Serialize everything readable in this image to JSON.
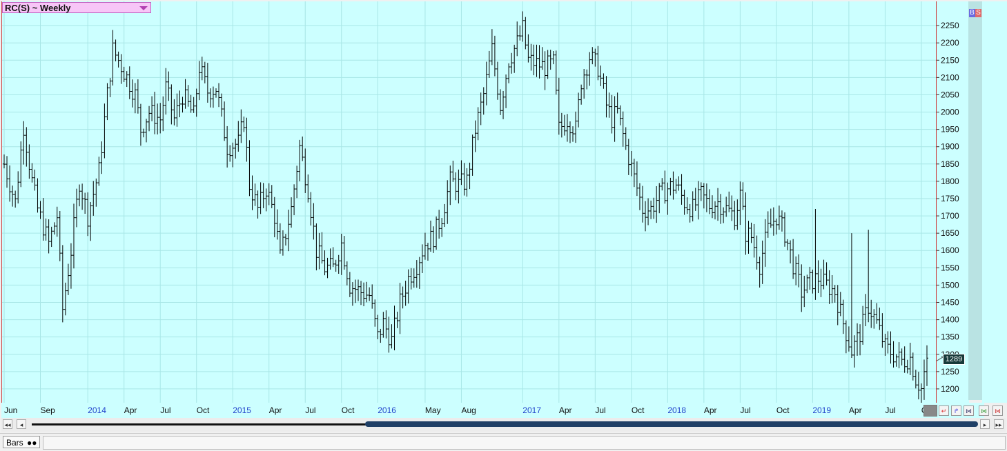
{
  "symbol_title": "RC(S) ~ Weekly",
  "bs_labels": {
    "b": "B",
    "s": "S"
  },
  "last_price": "1289",
  "status_tab": "Bars",
  "colors": {
    "background": "#ccffff",
    "bars": "#000000",
    "grid": "#a8e6e6"
  },
  "chart_data": {
    "type": "ohlc",
    "frequency": "weekly",
    "title": "RC(S) ~ Weekly",
    "ylim": [
      1160,
      2320
    ],
    "y_ticks": [
      1200,
      1250,
      1300,
      1350,
      1400,
      1450,
      1500,
      1550,
      1600,
      1650,
      1700,
      1750,
      1800,
      1850,
      1900,
      1950,
      2000,
      2050,
      2100,
      2150,
      2200,
      2250
    ],
    "x_ticks": [
      {
        "label": "Jun",
        "year": false,
        "pos": 0
      },
      {
        "label": "Sep",
        "year": false,
        "pos": 13
      },
      {
        "label": "2014",
        "year": true,
        "pos": 30
      },
      {
        "label": "Apr",
        "year": false,
        "pos": 43
      },
      {
        "label": "Jul",
        "year": false,
        "pos": 56
      },
      {
        "label": "Oct",
        "year": false,
        "pos": 69
      },
      {
        "label": "2015",
        "year": true,
        "pos": 82
      },
      {
        "label": "Apr",
        "year": false,
        "pos": 95
      },
      {
        "label": "Jul",
        "year": false,
        "pos": 108
      },
      {
        "label": "Oct",
        "year": false,
        "pos": 121
      },
      {
        "label": "2016",
        "year": true,
        "pos": 134
      },
      {
        "label": "May",
        "year": false,
        "pos": 151
      },
      {
        "label": "Aug",
        "year": false,
        "pos": 164
      },
      {
        "label": "2017",
        "year": true,
        "pos": 186
      },
      {
        "label": "Apr",
        "year": false,
        "pos": 199
      },
      {
        "label": "Jul",
        "year": false,
        "pos": 212
      },
      {
        "label": "Oct",
        "year": false,
        "pos": 225
      },
      {
        "label": "2018",
        "year": true,
        "pos": 238
      },
      {
        "label": "Apr",
        "year": false,
        "pos": 251
      },
      {
        "label": "Jul",
        "year": false,
        "pos": 264
      },
      {
        "label": "Oct",
        "year": false,
        "pos": 277
      },
      {
        "label": "2019",
        "year": true,
        "pos": 290
      },
      {
        "label": "Apr",
        "year": false,
        "pos": 303
      },
      {
        "label": "Jul",
        "year": false,
        "pos": 316
      },
      {
        "label": "Oct",
        "year": false,
        "pos": 329
      }
    ],
    "price_anchors": [
      [
        0,
        1850
      ],
      [
        4,
        1740
      ],
      [
        7,
        1960
      ],
      [
        10,
        1800
      ],
      [
        12,
        1720
      ],
      [
        16,
        1620
      ],
      [
        19,
        1700
      ],
      [
        21,
        1430
      ],
      [
        24,
        1600
      ],
      [
        27,
        1800
      ],
      [
        30,
        1700
      ],
      [
        34,
        1830
      ],
      [
        37,
        2050
      ],
      [
        39,
        2180
      ],
      [
        41,
        2150
      ],
      [
        44,
        2100
      ],
      [
        47,
        2050
      ],
      [
        49,
        1950
      ],
      [
        52,
        2000
      ],
      [
        56,
        1980
      ],
      [
        58,
        2070
      ],
      [
        61,
        1980
      ],
      [
        64,
        2050
      ],
      [
        68,
        1990
      ],
      [
        70,
        2130
      ],
      [
        73,
        2060
      ],
      [
        76,
        2070
      ],
      [
        80,
        1900
      ],
      [
        84,
        1910
      ],
      [
        86,
        1980
      ],
      [
        88,
        1790
      ],
      [
        91,
        1720
      ],
      [
        94,
        1780
      ],
      [
        97,
        1700
      ],
      [
        99,
        1580
      ],
      [
        103,
        1720
      ],
      [
        106,
        1900
      ],
      [
        109,
        1780
      ],
      [
        112,
        1600
      ],
      [
        115,
        1550
      ],
      [
        118,
        1550
      ],
      [
        121,
        1620
      ],
      [
        124,
        1500
      ],
      [
        128,
        1480
      ],
      [
        131,
        1470
      ],
      [
        134,
        1350
      ],
      [
        136,
        1390
      ],
      [
        139,
        1340
      ],
      [
        142,
        1450
      ],
      [
        145,
        1520
      ],
      [
        148,
        1560
      ],
      [
        151,
        1620
      ],
      [
        154,
        1640
      ],
      [
        157,
        1700
      ],
      [
        160,
        1800
      ],
      [
        163,
        1790
      ],
      [
        166,
        1800
      ],
      [
        169,
        1950
      ],
      [
        172,
        2050
      ],
      [
        175,
        2180
      ],
      [
        178,
        2020
      ],
      [
        181,
        2150
      ],
      [
        184,
        2200
      ],
      [
        186,
        2240
      ],
      [
        188,
        2150
      ],
      [
        191,
        2140
      ],
      [
        194,
        2130
      ],
      [
        197,
        2140
      ],
      [
        199,
        1950
      ],
      [
        202,
        1980
      ],
      [
        205,
        1950
      ],
      [
        207,
        2090
      ],
      [
        210,
        2160
      ],
      [
        213,
        2130
      ],
      [
        216,
        2020
      ],
      [
        218,
        1980
      ],
      [
        220,
        2000
      ],
      [
        223,
        1900
      ],
      [
        226,
        1810
      ],
      [
        229,
        1720
      ],
      [
        232,
        1720
      ],
      [
        235,
        1760
      ],
      [
        238,
        1780
      ],
      [
        241,
        1790
      ],
      [
        244,
        1740
      ],
      [
        247,
        1720
      ],
      [
        250,
        1760
      ],
      [
        253,
        1730
      ],
      [
        256,
        1740
      ],
      [
        259,
        1720
      ],
      [
        262,
        1700
      ],
      [
        264,
        1760
      ],
      [
        266,
        1650
      ],
      [
        268,
        1640
      ],
      [
        271,
        1560
      ],
      [
        274,
        1660
      ],
      [
        277,
        1700
      ],
      [
        280,
        1650
      ],
      [
        283,
        1560
      ],
      [
        286,
        1480
      ],
      [
        289,
        1510
      ],
      [
        292,
        1520
      ],
      [
        295,
        1500
      ],
      [
        298,
        1480
      ],
      [
        301,
        1390
      ],
      [
        304,
        1310
      ],
      [
        307,
        1360
      ],
      [
        310,
        1440
      ],
      [
        313,
        1390
      ],
      [
        316,
        1320
      ],
      [
        319,
        1300
      ],
      [
        322,
        1280
      ],
      [
        325,
        1290
      ],
      [
        327,
        1230
      ],
      [
        329,
        1200
      ],
      [
        331,
        1289
      ]
    ],
    "spikes": [
      [
        291,
        1720
      ],
      [
        304,
        1650
      ],
      [
        310,
        1660
      ]
    ],
    "n_bars": 332,
    "last": 1289
  }
}
